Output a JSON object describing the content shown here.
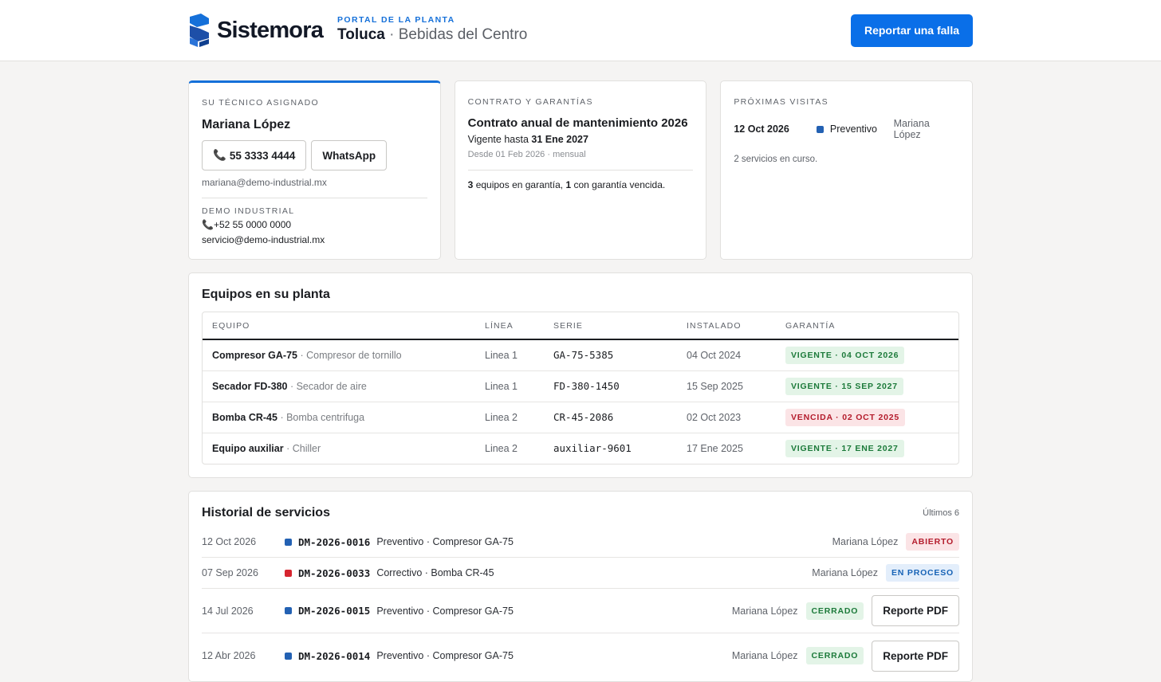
{
  "header": {
    "brand": "Sistemora",
    "kicker": "PORTAL DE LA PLANTA",
    "city": "Toluca",
    "separator": " · ",
    "company": "Bebidas del Centro",
    "report_button": "Reportar una falla"
  },
  "technician": {
    "kicker": "SU TÉCNICO ASIGNADO",
    "name": "Mariana López",
    "phone_button": "55 3333 4444",
    "whatsapp_button": "WhatsApp",
    "email": "mariana@demo-industrial.mx",
    "company_kicker": "DEMO INDUSTRIAL",
    "company_phone": "+52 55 0000 0000",
    "company_email": "servicio@demo-industrial.mx"
  },
  "contract": {
    "kicker": "CONTRATO Y GARANTÍAS",
    "title": "Contrato anual de mantenimiento 2026",
    "valid_prefix": "Vigente hasta ",
    "valid_until": "31 Ene 2027",
    "from": "Desde 01 Feb 2026 · mensual",
    "warranty_count": "3",
    "warranty_text_1": " equipos en garantía, ",
    "expired_count": "1",
    "warranty_text_2": " con garantía vencida."
  },
  "visits": {
    "kicker": "PRÓXIMAS VISITAS",
    "items": [
      {
        "date": "12 Oct 2026",
        "type": "Preventivo",
        "tech": "Mariana López",
        "color": "#2361b3"
      }
    ],
    "summary": "2 servicios en curso."
  },
  "equipment": {
    "title": "Equipos en su planta",
    "columns": [
      "EQUIPO",
      "LÍNEA",
      "SERIE",
      "INSTALADO",
      "GARANTÍA"
    ],
    "rows": [
      {
        "name": "Compresor GA-75",
        "type": " · Compresor de tornillo",
        "line": "Linea 1",
        "serial": "GA-75-5385",
        "installed": "04 Oct 2024",
        "warranty": "VIGENTE · 04 OCT 2026",
        "status": "green"
      },
      {
        "name": "Secador FD-380",
        "type": " · Secador de aire",
        "line": "Linea 1",
        "serial": "FD-380-1450",
        "installed": "15 Sep 2025",
        "warranty": "VIGENTE · 15 SEP 2027",
        "status": "green"
      },
      {
        "name": "Bomba CR-45",
        "type": " · Bomba centrifuga",
        "line": "Linea 2",
        "serial": "CR-45-2086",
        "installed": "02 Oct 2023",
        "warranty": "VENCIDA · 02 OCT 2025",
        "status": "red"
      },
      {
        "name": "Equipo auxiliar",
        "type": " · Chiller",
        "line": "Linea 2",
        "serial": "auxiliar-9601",
        "installed": "17 Ene 2025",
        "warranty": "VIGENTE · 17 ENE 2027",
        "status": "green"
      }
    ]
  },
  "history": {
    "title": "Historial de servicios",
    "count": "Últimos 6",
    "pdf_label": "Reporte PDF",
    "rows": [
      {
        "date": "12 Oct 2026",
        "code": "DM-2026-0016",
        "desc": "Preventivo · Compresor GA-75",
        "tech": "Mariana López",
        "status": "ABIERTO",
        "status_color": "red",
        "dot": "#2361b3",
        "pdf": false
      },
      {
        "date": "07 Sep 2026",
        "code": "DM-2026-0033",
        "desc": "Correctivo · Bomba CR-45",
        "tech": "Mariana López",
        "status": "EN PROCESO",
        "status_color": "blue",
        "dot": "#d6252f",
        "pdf": false
      },
      {
        "date": "14 Jul 2026",
        "code": "DM-2026-0015",
        "desc": "Preventivo · Compresor GA-75",
        "tech": "Mariana López",
        "status": "CERRADO",
        "status_color": "green",
        "dot": "#2361b3",
        "pdf": true
      },
      {
        "date": "12 Abr 2026",
        "code": "DM-2026-0014",
        "desc": "Preventivo · Compresor GA-75",
        "tech": "Mariana López",
        "status": "CERRADO",
        "status_color": "green",
        "dot": "#2361b3",
        "pdf": true
      }
    ]
  }
}
